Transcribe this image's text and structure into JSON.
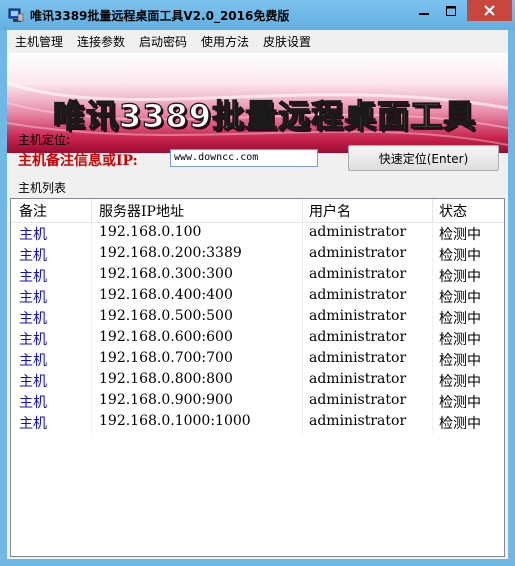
{
  "window": {
    "title": "唯讯3389批量远程桌面工具V2.0_2016免费版"
  },
  "menu": {
    "items": [
      "主机管理",
      "连接参数",
      "启动密码",
      "使用方法",
      "皮肤设置"
    ]
  },
  "banner": {
    "title": "唯讯3389批量远程桌面工具"
  },
  "locate": {
    "group_label": "主机定位:",
    "field_label": "主机备注信息或IP:",
    "input_value": "www.downcc.com",
    "button_label": "快速定位(Enter)"
  },
  "hostlist": {
    "group_label": "主机列表",
    "columns": [
      "备注",
      "服务器IP地址",
      "用户名",
      "状态"
    ],
    "rows": [
      {
        "note": "主机",
        "ip": "192.168.0.100",
        "user": "administrator",
        "status": "检测中"
      },
      {
        "note": "主机",
        "ip": "192.168.0.200:3389",
        "user": "administrator",
        "status": "检测中"
      },
      {
        "note": "主机",
        "ip": "192.168.0.300:300",
        "user": "administrator",
        "status": "检测中"
      },
      {
        "note": "主机",
        "ip": "192.168.0.400:400",
        "user": "administrator",
        "status": "检测中"
      },
      {
        "note": "主机",
        "ip": "192.168.0.500:500",
        "user": "administrator",
        "status": "检测中"
      },
      {
        "note": "主机",
        "ip": "192.168.0.600:600",
        "user": "administrator",
        "status": "检测中"
      },
      {
        "note": "主机",
        "ip": "192.168.0.700:700",
        "user": "administrator",
        "status": "检测中"
      },
      {
        "note": "主机",
        "ip": "192.168.0.800:800",
        "user": "administrator",
        "status": "检测中"
      },
      {
        "note": "主机",
        "ip": "192.168.0.900:900",
        "user": "administrator",
        "status": "检测中"
      },
      {
        "note": "主机",
        "ip": "192.168.0.1000:1000",
        "user": "administrator",
        "status": "检测中"
      }
    ]
  },
  "colors": {
    "titlebar": "#6fb8e6",
    "close_button": "#c9463d",
    "field_label": "#cc0000",
    "note_text": "#1010c8"
  },
  "icons": [
    "app-icon",
    "minimize-icon",
    "maximize-icon",
    "close-icon"
  ]
}
